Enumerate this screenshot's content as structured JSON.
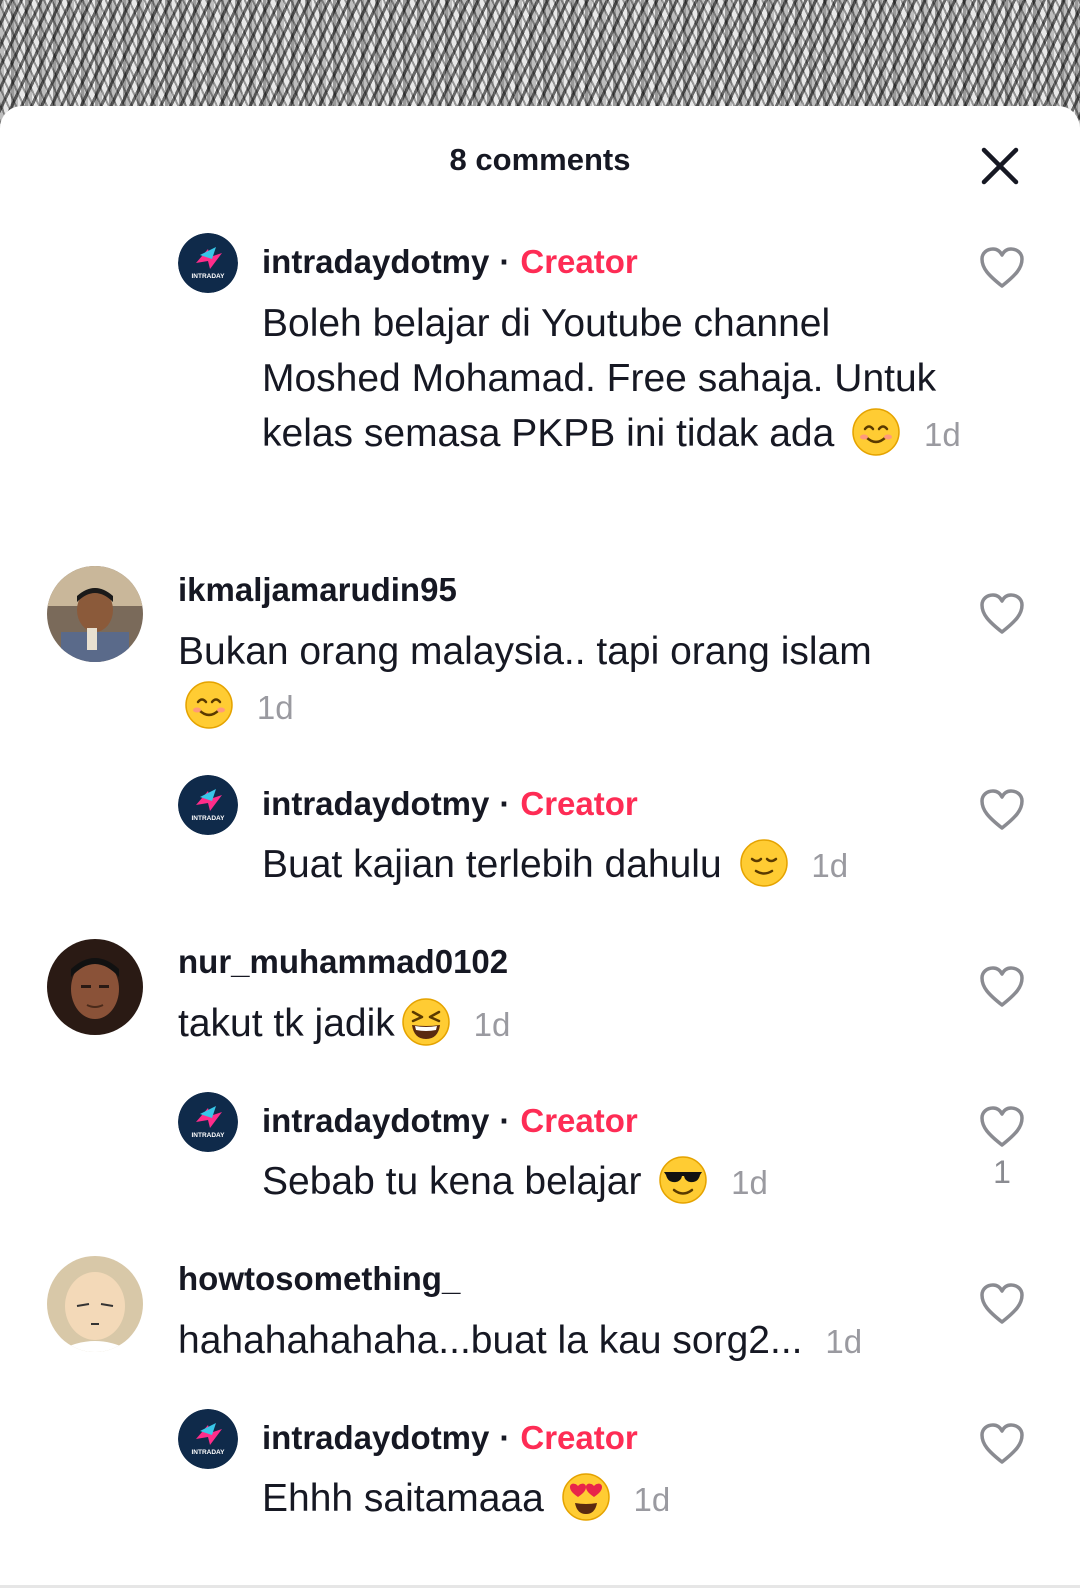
{
  "header": {
    "title": "8 comments"
  },
  "colors": {
    "creator": "#fe2c55",
    "text": "#161823",
    "muted": "#9a9aa0"
  },
  "comments": [
    {
      "user": "intradaydotmy",
      "badge": "Creator",
      "sep": "·",
      "text": "Boleh belajar di Youtube channel Moshed Mohamad. Free sahaja. Untuk kelas semasa PKPB ini tidak ada",
      "emoji": "smiling-face-icon",
      "time": "1d",
      "reply": true
    },
    {
      "user": "ikmaljamarudin95",
      "text": "Bukan orang malaysia.. tapi orang islam",
      "emoji": "smiling-face-icon",
      "time": "1d",
      "reply": false
    },
    {
      "user": "intradaydotmy",
      "badge": "Creator",
      "sep": "·",
      "text": "Buat kajian terlebih dahulu",
      "emoji": "relieved-face-icon",
      "time": "1d",
      "reply": true
    },
    {
      "user": "nur_muhammad0102",
      "text": "takut tk jadik",
      "emoji": "laughing-face-icon",
      "time": "1d",
      "reply": false
    },
    {
      "user": "intradaydotmy",
      "badge": "Creator",
      "sep": "·",
      "text": "Sebab tu kena belajar",
      "emoji": "sunglasses-face-icon",
      "time": "1d",
      "likes": "1",
      "reply": true
    },
    {
      "user": "howtosomething_",
      "text": "hahahahahaha...buat la kau sorg2...",
      "time": "1d",
      "reply": false
    },
    {
      "user": "intradaydotmy",
      "badge": "Creator",
      "sep": "·",
      "text": "Ehhh saitamaaa",
      "emoji": "heart-eyes-face-icon",
      "time": "1d",
      "reply": true
    }
  ]
}
